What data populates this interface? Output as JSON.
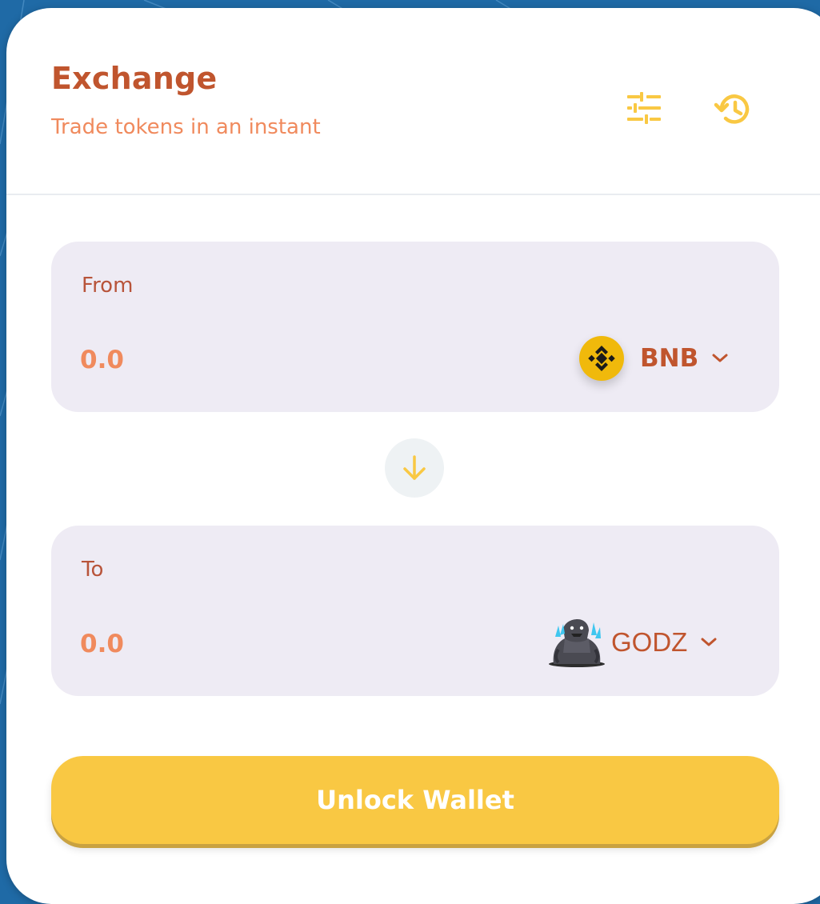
{
  "header": {
    "title": "Exchange",
    "subtitle": "Trade tokens in an instant",
    "settings_icon": "sliders-icon",
    "history_icon": "history-icon"
  },
  "from": {
    "label": "From",
    "amount_placeholder": "0.0",
    "token_symbol": "BNB",
    "token_icon": "bnb-logo"
  },
  "to": {
    "label": "To",
    "amount_placeholder": "0.0",
    "token_symbol": "GODZ",
    "token_icon": "godz-logo"
  },
  "swap": {
    "icon": "arrow-down-icon"
  },
  "action": {
    "unlock_label": "Unlock Wallet"
  },
  "colors": {
    "brand": "#c0552e",
    "accent": "#f9c843",
    "muted_orange": "#f08a5d",
    "panel_bg": "#eeebf4",
    "page_bg": "#1f6aa6"
  }
}
